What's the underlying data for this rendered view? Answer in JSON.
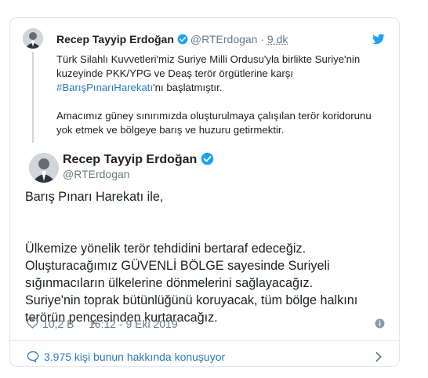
{
  "quoted_tweet": {
    "author_name": "Recep Tayyip Erdoğan",
    "handle": "@RTErdogan",
    "separator": "·",
    "time": "9 dk",
    "paragraph1_before": "Türk Silahlı Kuvvetleri'miz Suriye Milli Ordusu'yla birlikte Suriye'nin kuzeyinde PKK/YPG ve Deaş terör örgütlerine karşı ",
    "paragraph1_hashtag": "#BarışPınarıHarekatı",
    "paragraph1_after": "'nı başlatmıştır.",
    "paragraph2": "Amacımız güney sınırımızda oluşturulmaya çalışılan terör koridorunu yok etmek ve bölgeye barış ve huzuru getirmektir."
  },
  "main_tweet": {
    "author_name": "Recep Tayyip Erdoğan",
    "handle": "@RTErdogan",
    "line1": "Barış Pınarı Harekatı ile,",
    "line2": "Ülkemize yönelik terör tehdidini bertaraf edeceğiz.",
    "line3": "Oluşturacağımız GÜVENLİ BÖLGE sayesinde Suriyeli",
    "line4": "sığınmacıların ülkelerine dönmelerini sağlayacağız.",
    "line5": "Suriye'nin toprak bütünlüğünü koruyacak, tüm bölge halkını",
    "line6": "terörün pençesinden kurtaracağız.",
    "likes": "10,2 B",
    "datetime": "16:12 - 9 Eki 2019"
  },
  "footer": {
    "conversation_text": "3.975 kişi bunun hakkında konuşuyor"
  },
  "icons": {
    "brand": "twitter-bird-icon",
    "verified": "verified-badge-icon",
    "like": "heart-icon",
    "info": "info-icon",
    "reply": "comment-bubble-icon",
    "chevron": "chevron-right-icon"
  },
  "colors": {
    "link": "#2b7bb9",
    "muted": "#697882",
    "text": "#1c2022",
    "twitter_blue": "#1da1f2",
    "border": "#e1e8ed"
  }
}
